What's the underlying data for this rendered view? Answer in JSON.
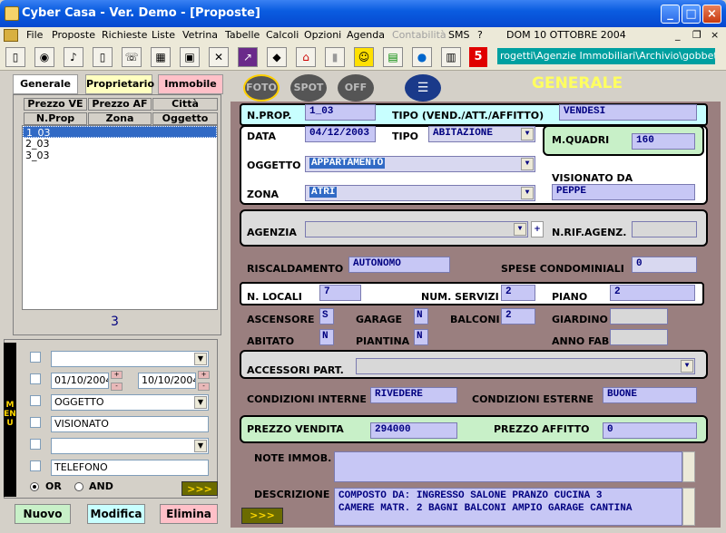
{
  "window": {
    "title": "Cyber Casa - Ver. Demo - [Proposte]"
  },
  "menu": [
    "File",
    "Proposte",
    "Richieste",
    "Liste",
    "Vetrina",
    "Tabelle",
    "Calcoli",
    "Opzioni",
    "Agenda",
    "Contabilità",
    "SMS",
    "?"
  ],
  "menu_date": "DOM 10 OTTOBRE 2004",
  "toolbar": {
    "path": "rogetti\\Agenzie Immobiliari\\Archivio\\gobbetti.mdc",
    "badge": "5"
  },
  "left_tabs": [
    "Generale",
    "Proprietario",
    "Immobile"
  ],
  "list_headers": {
    "r1": [
      "Prezzo VE",
      "Prezzo AF",
      "Città"
    ],
    "r2": [
      "N.Prop",
      "Zona",
      "Oggetto"
    ]
  },
  "list_items": [
    "1_03",
    "2_03",
    "3_03"
  ],
  "list_count": "3",
  "filters": {
    "date_from": "01/10/2004",
    "date_to": "10/10/2004",
    "oggetto": "OGGETTO",
    "visionato": "VISIONATO",
    "telefono": "TELEFONO",
    "or_label": "OR",
    "and_label": "AND",
    "go": ">>>"
  },
  "buttons": {
    "nuovo": "Nuovo",
    "modifica": "Modifica",
    "elimina": "Elimina"
  },
  "top_icons": [
    "FOTO",
    "SPOT",
    "OFF"
  ],
  "section_title": "GENERALE",
  "form": {
    "nprop_label": "N.PROP.",
    "nprop": "1_03",
    "tipo_label": "TIPO (VEND./ATT./AFFITTO)",
    "tipo": "VENDESI",
    "data_label": "DATA",
    "data": "04/12/2003",
    "tipo2_label": "TIPO",
    "tipo2": "ABITAZIONE",
    "mq_label": "M.QUADRI",
    "mq": "160",
    "oggetto_label": "OGGETTO",
    "oggetto": "APPARTAMENTO",
    "vis_label": "VISIONATO DA",
    "vis": "PEPPE",
    "zona_label": "ZONA",
    "zona": "ATRI",
    "agenzia_label": "AGENZIA",
    "agenzia": "",
    "nrif_label": "N.RIF.AGENZ.",
    "nrif": "",
    "risc_label": "RISCALDAMENTO",
    "risc": "AUTONOMO",
    "spese_label": "SPESE CONDOMINIALI",
    "spese": "0",
    "locali_label": "N. LOCALI",
    "locali": "7",
    "servizi_label": "NUM. SERVIZI",
    "servizi": "2",
    "piano_label": "PIANO",
    "piano": "2",
    "asc_label": "ASCENSORE",
    "asc": "S",
    "garage_label": "GARAGE",
    "garage": "N",
    "balconi_label": "BALCONI",
    "balconi": "2",
    "giardino_label": "GIARDINO",
    "giardino": "",
    "abitato_label": "ABITATO",
    "abitato": "N",
    "piantina_label": "PIANTINA",
    "piantina": "N",
    "annofab_label": "ANNO FAB.",
    "annofab": "",
    "accessori_label": "ACCESSORI PART.",
    "accessori": "",
    "condint_label": "CONDIZIONI INTERNE",
    "condint": "RIVEDERE",
    "condest_label": "CONDIZIONI ESTERNE",
    "condest": "BUONE",
    "pv_label": "PREZZO VENDITA",
    "pv": "294000",
    "pa_label": "PREZZO AFFITTO",
    "pa": "0",
    "note_label": "NOTE IMMOB.",
    "note": "",
    "desc_label": "DESCRIZIONE",
    "desc1": "COMPOSTO DA: INGRESSO SALONE PRANZO CUCINA 3",
    "desc2": "CAMERE MATR. 2 BAGNI BALCONI AMPIO GARAGE CANTINA",
    "go": ">>>"
  },
  "menu_vertical": "MENU"
}
